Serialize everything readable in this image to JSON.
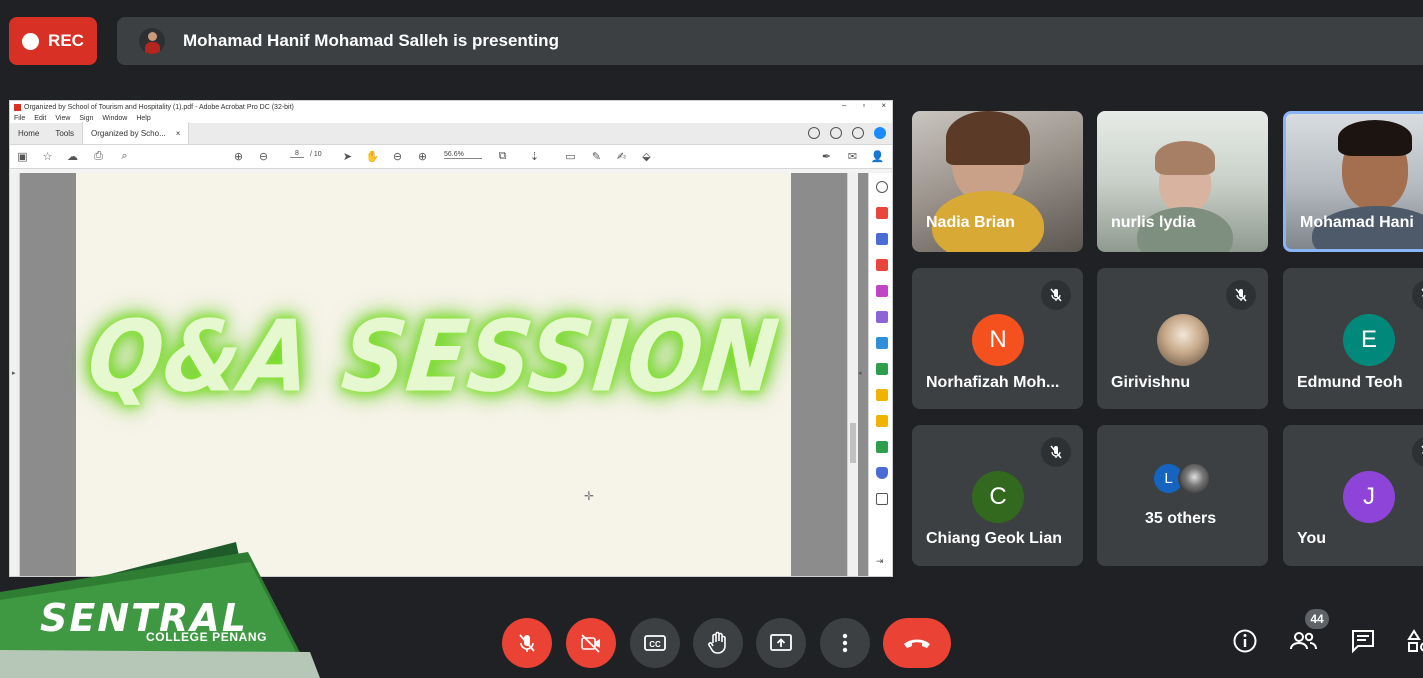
{
  "recording": {
    "label": "REC"
  },
  "presenting": {
    "text": "Mohamad Hanif Mohamad Salleh is presenting"
  },
  "acrobat": {
    "window_title": "Organized by School of Tourism and Hospitality (1).pdf - Adobe Acrobat Pro DC (32-bit)",
    "menu": [
      "File",
      "Edit",
      "View",
      "Sign",
      "Window",
      "Help"
    ],
    "tabs": {
      "home": "Home",
      "tools": "Tools",
      "document": "Organized by Scho...",
      "close": "×"
    },
    "page_current": "8",
    "page_total": "/ 10",
    "zoom": "56.6%",
    "slide_text": "Q&A SESSION"
  },
  "participants": [
    {
      "name": "Nadia Brian"
    },
    {
      "name": "nurlis lydia"
    },
    {
      "name": "Mohamad Hani"
    },
    {
      "name": "Norhafizah Moh...",
      "initial": "N",
      "color": "#f4511e"
    },
    {
      "name": "Girivishnu"
    },
    {
      "name": "Edmund Teoh",
      "initial": "E",
      "color": "#00897b"
    },
    {
      "name": "Chiang Geok Lian",
      "initial": "C",
      "color": "#33691e"
    },
    {
      "name": "35 others",
      "initial": "L",
      "color": "#1565c0"
    },
    {
      "name": "You",
      "initial": "J",
      "color": "#8e44d9"
    }
  ],
  "controls": {
    "people_count": "44"
  },
  "logo": {
    "main": "SENTRAL",
    "sub": "COLLEGE PENANG"
  },
  "colors": {
    "red": "#ea4335",
    "tile": "#3c4043",
    "bg": "#202124",
    "accent": "#8ab4f8"
  }
}
